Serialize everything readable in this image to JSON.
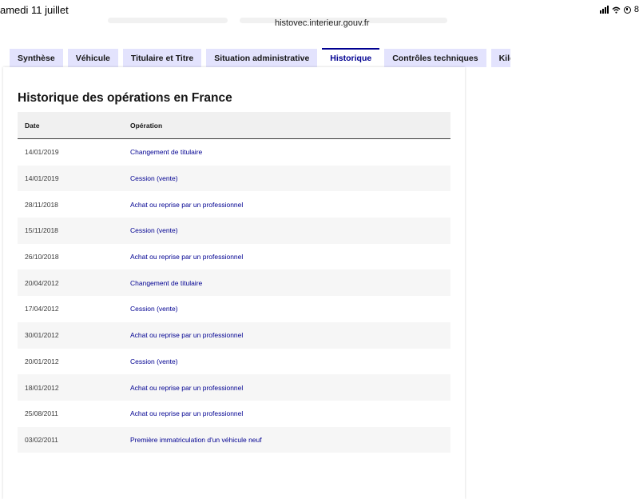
{
  "status_bar": {
    "time": "amedi 11 juillet",
    "url": "histovec.interieur.gouv.fr",
    "battery": "8"
  },
  "tabs": [
    {
      "label": "Synthèse",
      "active": false
    },
    {
      "label": "Véhicule",
      "active": false
    },
    {
      "label": "Titulaire et Titre",
      "active": false
    },
    {
      "label": "Situation administrative",
      "active": false
    },
    {
      "label": "Historique",
      "active": true
    },
    {
      "label": "Contrôles techniques",
      "active": false
    },
    {
      "label": "Kilo",
      "active": false
    }
  ],
  "section": {
    "title": "Historique des opérations en France",
    "columns": [
      "Date",
      "Opération"
    ],
    "rows": [
      {
        "date": "14/01/2019",
        "operation": "Changement de titulaire"
      },
      {
        "date": "14/01/2019",
        "operation": "Cession (vente)"
      },
      {
        "date": "28/11/2018",
        "operation": "Achat ou reprise par un professionnel"
      },
      {
        "date": "15/11/2018",
        "operation": "Cession (vente)"
      },
      {
        "date": "26/10/2018",
        "operation": "Achat ou reprise par un professionnel"
      },
      {
        "date": "20/04/2012",
        "operation": "Changement de titulaire"
      },
      {
        "date": "17/04/2012",
        "operation": "Cession (vente)"
      },
      {
        "date": "30/01/2012",
        "operation": "Achat ou reprise par un professionnel"
      },
      {
        "date": "20/01/2012",
        "operation": "Cession (vente)"
      },
      {
        "date": "18/01/2012",
        "operation": "Achat ou reprise par un professionnel"
      },
      {
        "date": "25/08/2011",
        "operation": "Achat ou reprise par un professionnel"
      },
      {
        "date": "03/02/2011",
        "operation": "Première immatriculation d'un véhicule neuf"
      }
    ]
  },
  "colors": {
    "accent": "#000091",
    "tab_bg": "#e3e3fd",
    "header_bg": "#f0f0f0",
    "stripe_bg": "#f6f6f6"
  }
}
